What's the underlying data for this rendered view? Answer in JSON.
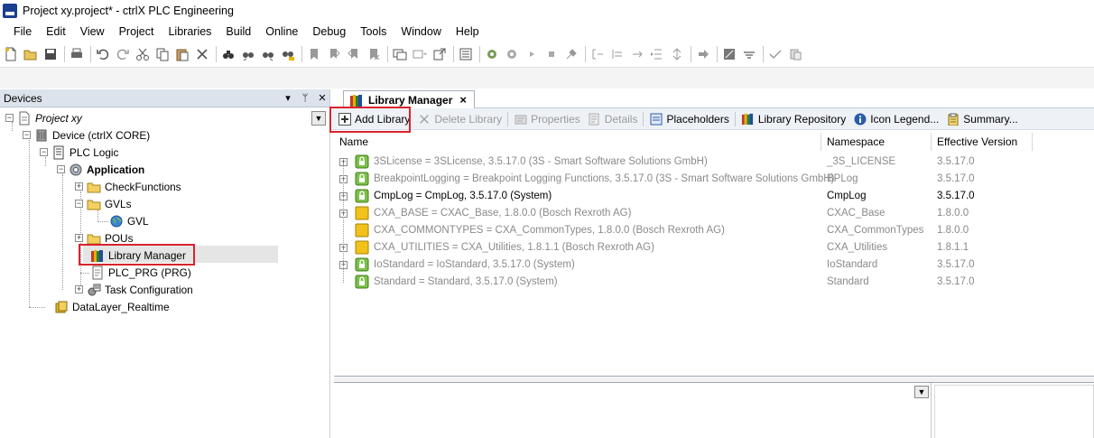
{
  "window": {
    "title": "Project xy.project* - ctrlX PLC Engineering"
  },
  "menu": [
    "File",
    "Edit",
    "View",
    "Project",
    "Libraries",
    "Build",
    "Online",
    "Debug",
    "Tools",
    "Window",
    "Help"
  ],
  "devices_panel": {
    "title": "Devices",
    "controls": [
      "▾",
      "ᛘ",
      "✕"
    ],
    "tree": {
      "project": "Project xy",
      "device": "Device (ctrlX CORE)",
      "plc_logic": "PLC Logic",
      "application": "Application",
      "check_functions": "CheckFunctions",
      "gvls": "GVLs",
      "gvl": "GVL",
      "pous": "POUs",
      "library_manager": "Library Manager",
      "plc_prg": "PLC_PRG (PRG)",
      "task_configuration": "Task Configuration",
      "datalayer": "DataLayer_Realtime"
    }
  },
  "library_manager": {
    "tab_label": "Library Manager",
    "toolbar": {
      "add_library": "Add Library",
      "delete_library": "Delete Library",
      "properties": "Properties",
      "details": "Details",
      "placeholders": "Placeholders",
      "library_repository": "Library Repository",
      "icon_legend": "Icon Legend...",
      "summary": "Summary..."
    },
    "columns": {
      "name": "Name",
      "namespace": "Namespace",
      "effective_version": "Effective Version"
    },
    "rows": [
      {
        "name": "3SLicense = 3SLicense, 3.5.17.0 (3S - Smart Software Solutions GmbH)",
        "namespace": "_3S_LICENSE",
        "version": "3.5.17.0",
        "icon": "green-lock",
        "active": false
      },
      {
        "name": "BreakpointLogging = Breakpoint Logging Functions, 3.5.17.0 (3S - Smart Software Solutions GmbH)",
        "namespace": "BPLog",
        "version": "3.5.17.0",
        "icon": "green-lock",
        "active": false
      },
      {
        "name": "CmpLog = CmpLog, 3.5.17.0 (System)",
        "namespace": "CmpLog",
        "version": "3.5.17.0",
        "icon": "green-lock",
        "active": true
      },
      {
        "name": "CXA_BASE = CXAC_Base, 1.8.0.0 (Bosch Rexroth AG)",
        "namespace": "CXAC_Base",
        "version": "1.8.0.0",
        "icon": "yellow-lib",
        "active": false
      },
      {
        "name": "CXA_COMMONTYPES = CXA_CommonTypes, 1.8.0.0 (Bosch Rexroth AG)",
        "namespace": "CXA_CommonTypes",
        "version": "1.8.0.0",
        "icon": "yellow-lib",
        "active": false
      },
      {
        "name": "CXA_UTILITIES = CXA_Utilities, 1.8.1.1 (Bosch Rexroth AG)",
        "namespace": "CXA_Utilities",
        "version": "1.8.1.1",
        "icon": "yellow-lib",
        "active": false
      },
      {
        "name": "IoStandard = IoStandard, 3.5.17.0 (System)",
        "namespace": "IoStandard",
        "version": "3.5.17.0",
        "icon": "green-lock",
        "active": false
      },
      {
        "name": "Standard = Standard, 3.5.17.0 (System)",
        "namespace": "Standard",
        "version": "3.5.17.0",
        "icon": "green-lock",
        "active": false
      }
    ]
  },
  "colors": {
    "highlight": "#d9232e",
    "header_bg": "#dde3ec",
    "toolbar_bg": "#eef1f6",
    "disabled_text": "#8a8a8a"
  }
}
